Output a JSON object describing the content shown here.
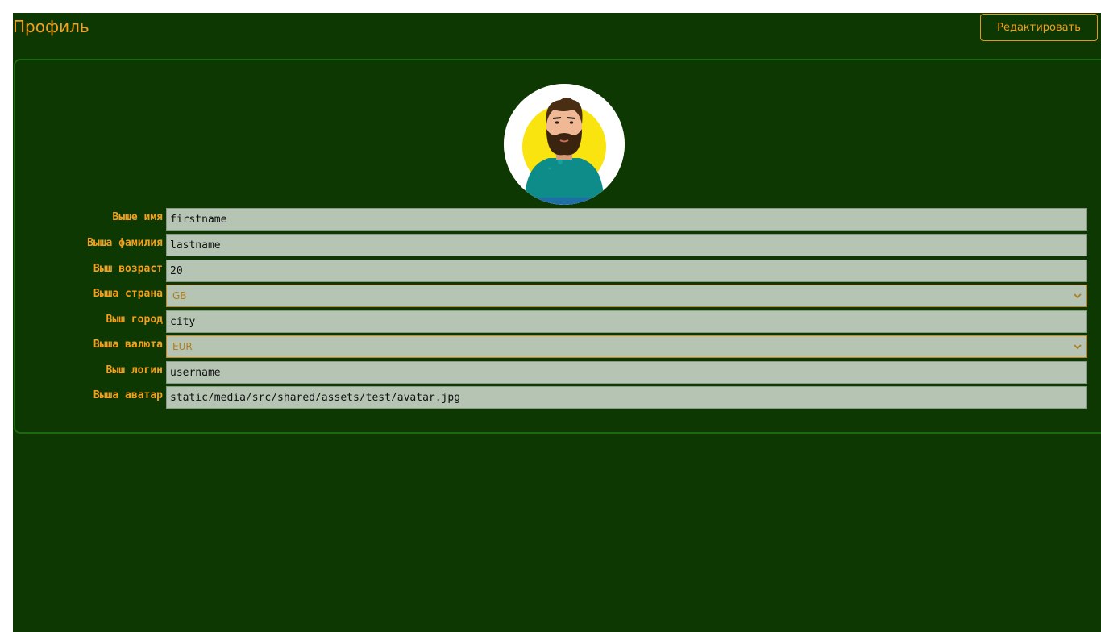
{
  "header": {
    "title": "Профиль",
    "edit_label": "Редактировать"
  },
  "profile": {
    "avatar_icon": "avatar-bearded-man",
    "fields": [
      {
        "label": "Выше имя",
        "value": "firstname",
        "kind": "input"
      },
      {
        "label": "Выша фамилия",
        "value": "lastname",
        "kind": "input"
      },
      {
        "label": "Выш возраст",
        "value": "20",
        "kind": "input"
      },
      {
        "label": "Выша страна",
        "value": "GB",
        "kind": "select"
      },
      {
        "label": "Выш город",
        "value": "city",
        "kind": "input"
      },
      {
        "label": "Выша валюта",
        "value": "EUR",
        "kind": "select"
      },
      {
        "label": "Выш логин",
        "value": "username",
        "kind": "input"
      },
      {
        "label": "Выша аватар",
        "value": "static/media/src/shared/assets/test/avatar.jpg",
        "kind": "input"
      }
    ]
  },
  "colors": {
    "background": "#0d3801",
    "accent": "#f59f1a",
    "field_bg": "#b6c4b4",
    "card_border": "#1c6a10"
  }
}
